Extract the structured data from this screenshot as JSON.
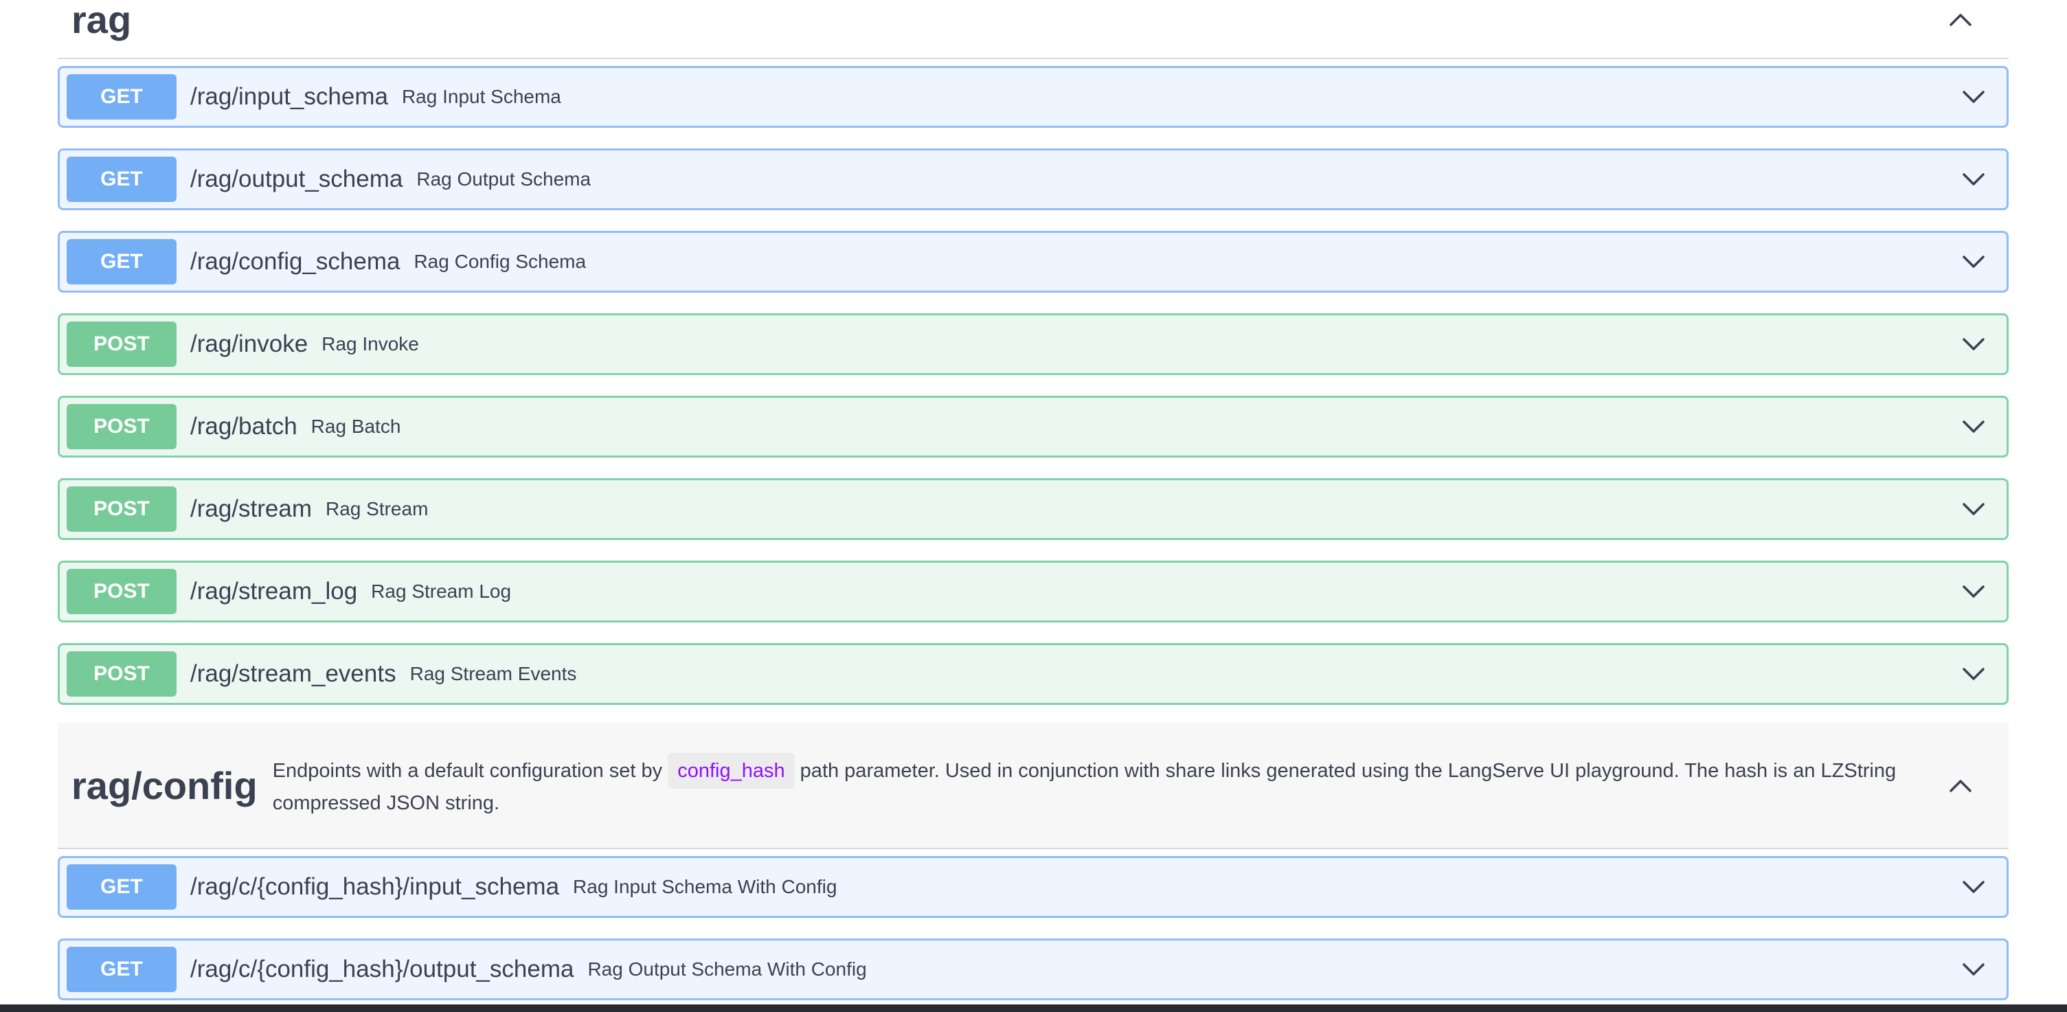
{
  "sections": [
    {
      "tag": "rag",
      "description": "",
      "operations": [
        {
          "method": "GET",
          "path": "/rag/input_schema",
          "summary": "Rag Input Schema"
        },
        {
          "method": "GET",
          "path": "/rag/output_schema",
          "summary": "Rag Output Schema"
        },
        {
          "method": "GET",
          "path": "/rag/config_schema",
          "summary": "Rag Config Schema"
        },
        {
          "method": "POST",
          "path": "/rag/invoke",
          "summary": "Rag Invoke"
        },
        {
          "method": "POST",
          "path": "/rag/batch",
          "summary": "Rag Batch"
        },
        {
          "method": "POST",
          "path": "/rag/stream",
          "summary": "Rag Stream"
        },
        {
          "method": "POST",
          "path": "/rag/stream_log",
          "summary": "Rag Stream Log"
        },
        {
          "method": "POST",
          "path": "/rag/stream_events",
          "summary": "Rag Stream Events"
        }
      ]
    },
    {
      "tag": "rag/config",
      "description_before": "Endpoints with a default configuration set by ",
      "description_code": "config_hash",
      "description_after": " path parameter. Used in conjunction with share links generated using the LangServe UI playground. The hash is an LZString compressed JSON string.",
      "operations": [
        {
          "method": "GET",
          "path": "/rag/c/{config_hash}/input_schema",
          "summary": "Rag Input Schema With Config"
        },
        {
          "method": "GET",
          "path": "/rag/c/{config_hash}/output_schema",
          "summary": "Rag Output Schema With Config"
        }
      ]
    }
  ],
  "icons": {
    "collapse": "chevron-up-icon",
    "expand": "chevron-down-icon"
  },
  "colors": {
    "get_badge": "#74aef5",
    "get_border": "#8fbdf7",
    "get_background": "#eff5fe",
    "post_badge": "#77cb98",
    "post_border": "#7fd3a7",
    "post_background": "#ecf7f2",
    "code_text": "#9012fe",
    "text": "#3b4151"
  }
}
